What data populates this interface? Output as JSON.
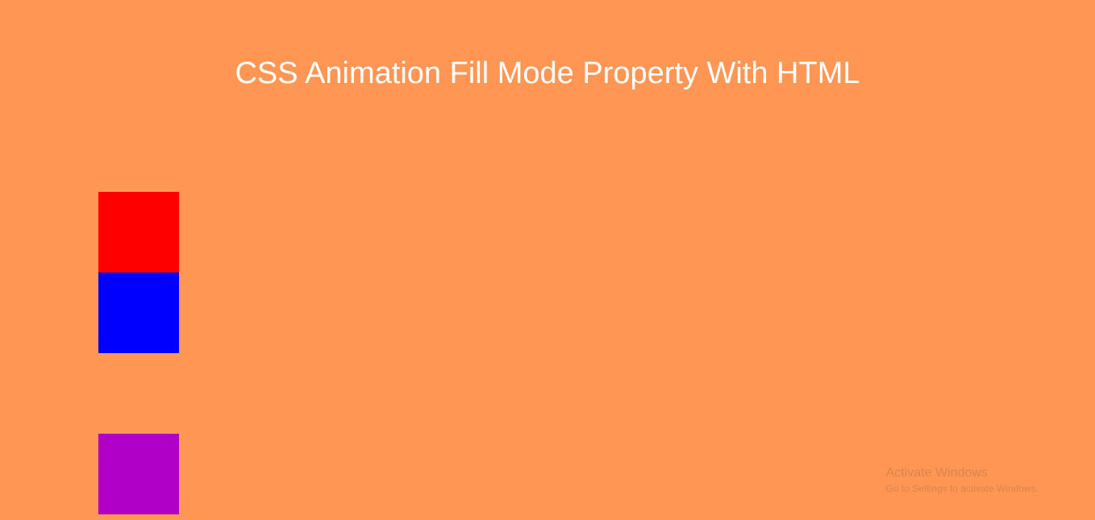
{
  "heading": "CSS Animation Fill Mode Property With HTML",
  "boxes": {
    "red_color": "#ff0000",
    "blue_color": "#0000ff",
    "purple_color": "#b000c8"
  },
  "watermark": {
    "title": "Activate Windows",
    "subtitle": "Go to Settings to activate Windows."
  }
}
